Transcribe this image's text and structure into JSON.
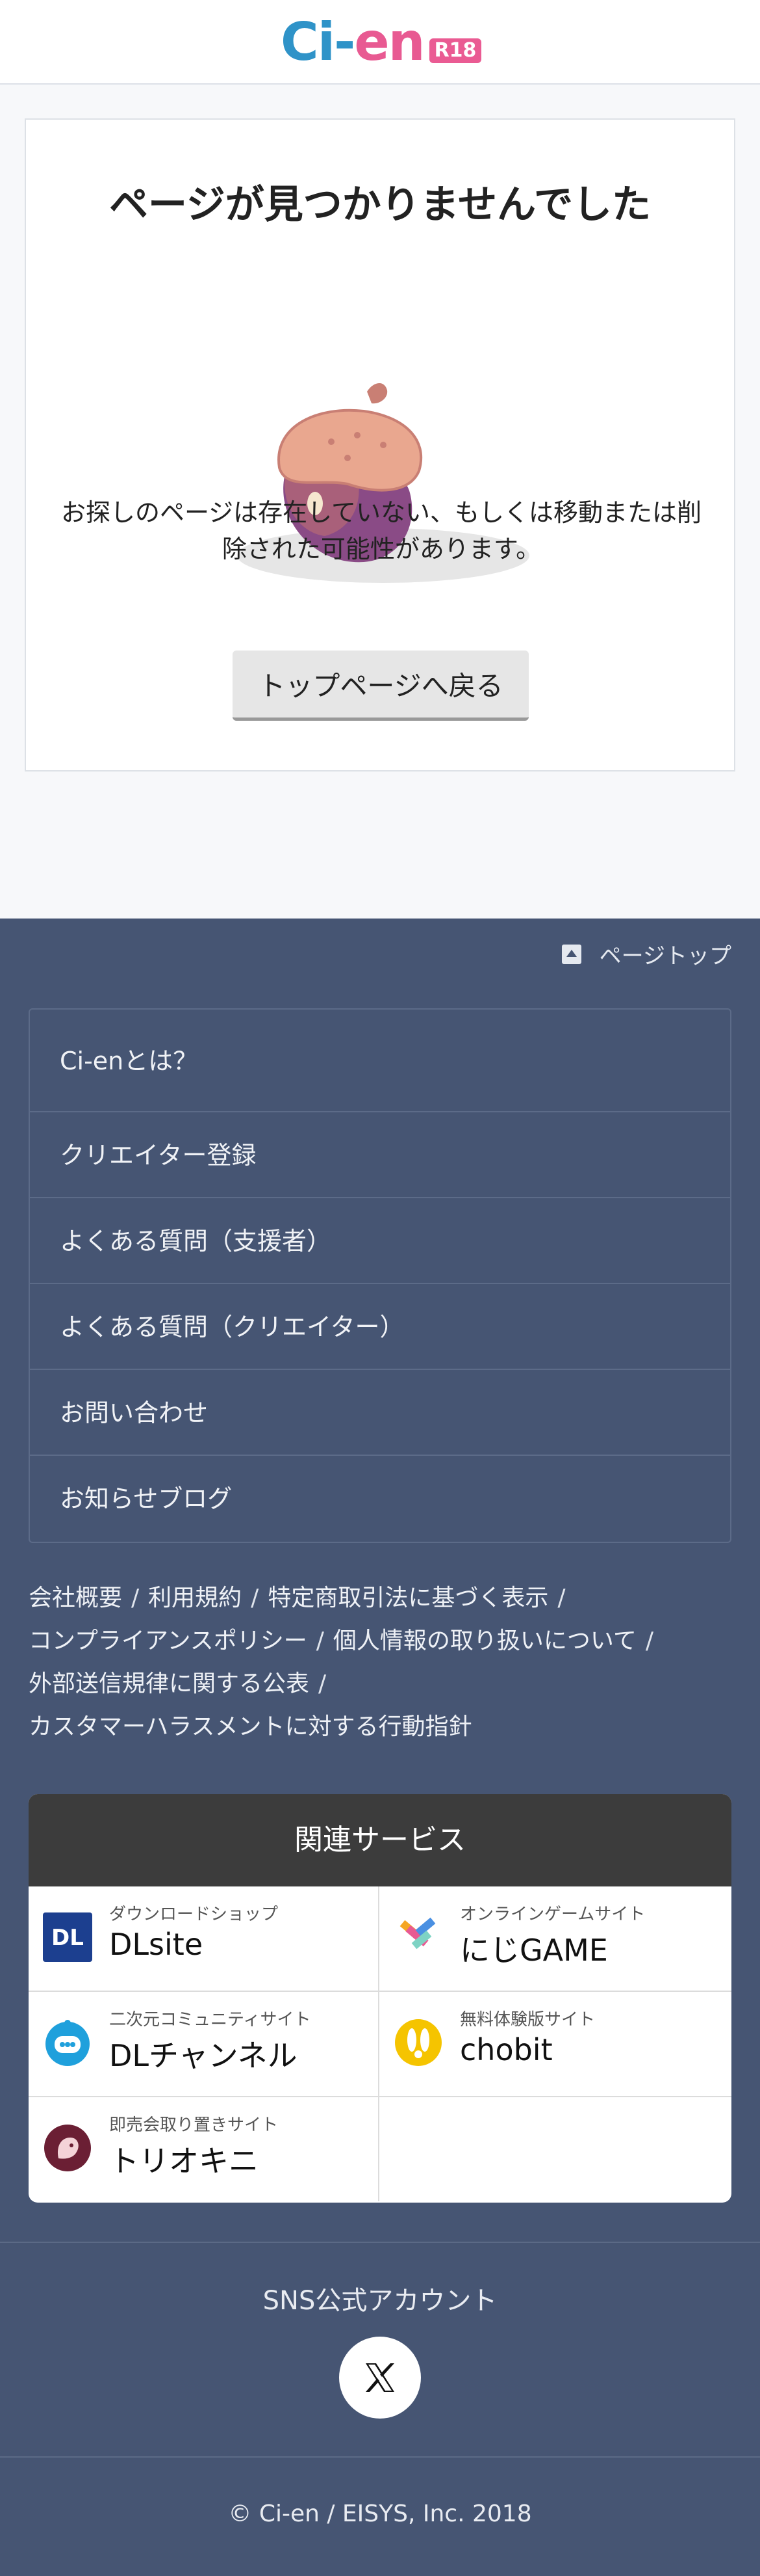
{
  "header": {
    "logo_text_ci": "Ci-",
    "logo_text_en": "en",
    "logo_badge": "R18"
  },
  "card": {
    "title": "ページが見つかりませんでした",
    "message": "お探しのページは存在していない、もしくは移動または削除された可能性があります。",
    "back_button": "トップページへ戻る"
  },
  "footer": {
    "page_top": "ページトップ",
    "menu": [
      {
        "label": "Ci-enとは？"
      },
      {
        "label": "クリエイター登録"
      },
      {
        "label": "よくある質問（支援者）"
      },
      {
        "label": "よくある質問（クリエイター）"
      },
      {
        "label": "お問い合わせ"
      },
      {
        "label": "お知らせブログ"
      }
    ],
    "links": [
      "会社概要",
      "利用規約",
      "特定商取引法に基づく表示",
      "コンプライアンスポリシー",
      "個人情報の取り扱いについて",
      "外部送信規律に関する公表",
      "カスタマーハラスメントに対する行動指針"
    ],
    "link_separator": "/",
    "services": {
      "heading": "関連サービス",
      "items": [
        {
          "sub": "ダウンロードショップ",
          "name": "DLsite",
          "logo_text": "DL",
          "icon": "dlsite-logo-icon"
        },
        {
          "sub": "オンラインゲームサイト",
          "name": "にじGAME",
          "icon": "nijigame-logo-icon"
        },
        {
          "sub": "二次元コミュニティサイト",
          "name": "DLチャンネル",
          "icon": "dlchannel-logo-icon"
        },
        {
          "sub": "無料体験版サイト",
          "name": "chobit",
          "icon": "chobit-logo-icon"
        },
        {
          "sub": "即売会取り置きサイト",
          "name": "トリオキニ",
          "icon": "toriokini-logo-icon"
        }
      ]
    },
    "sns_title": "SNS公式アカウント",
    "copyright": "© Ci-en / EISYS, Inc. 2018"
  },
  "colors": {
    "logo_blue": "#2f93c8",
    "logo_pink": "#e85a92",
    "footer_bg": "#465573",
    "services_head_bg": "#3c3c3c"
  }
}
